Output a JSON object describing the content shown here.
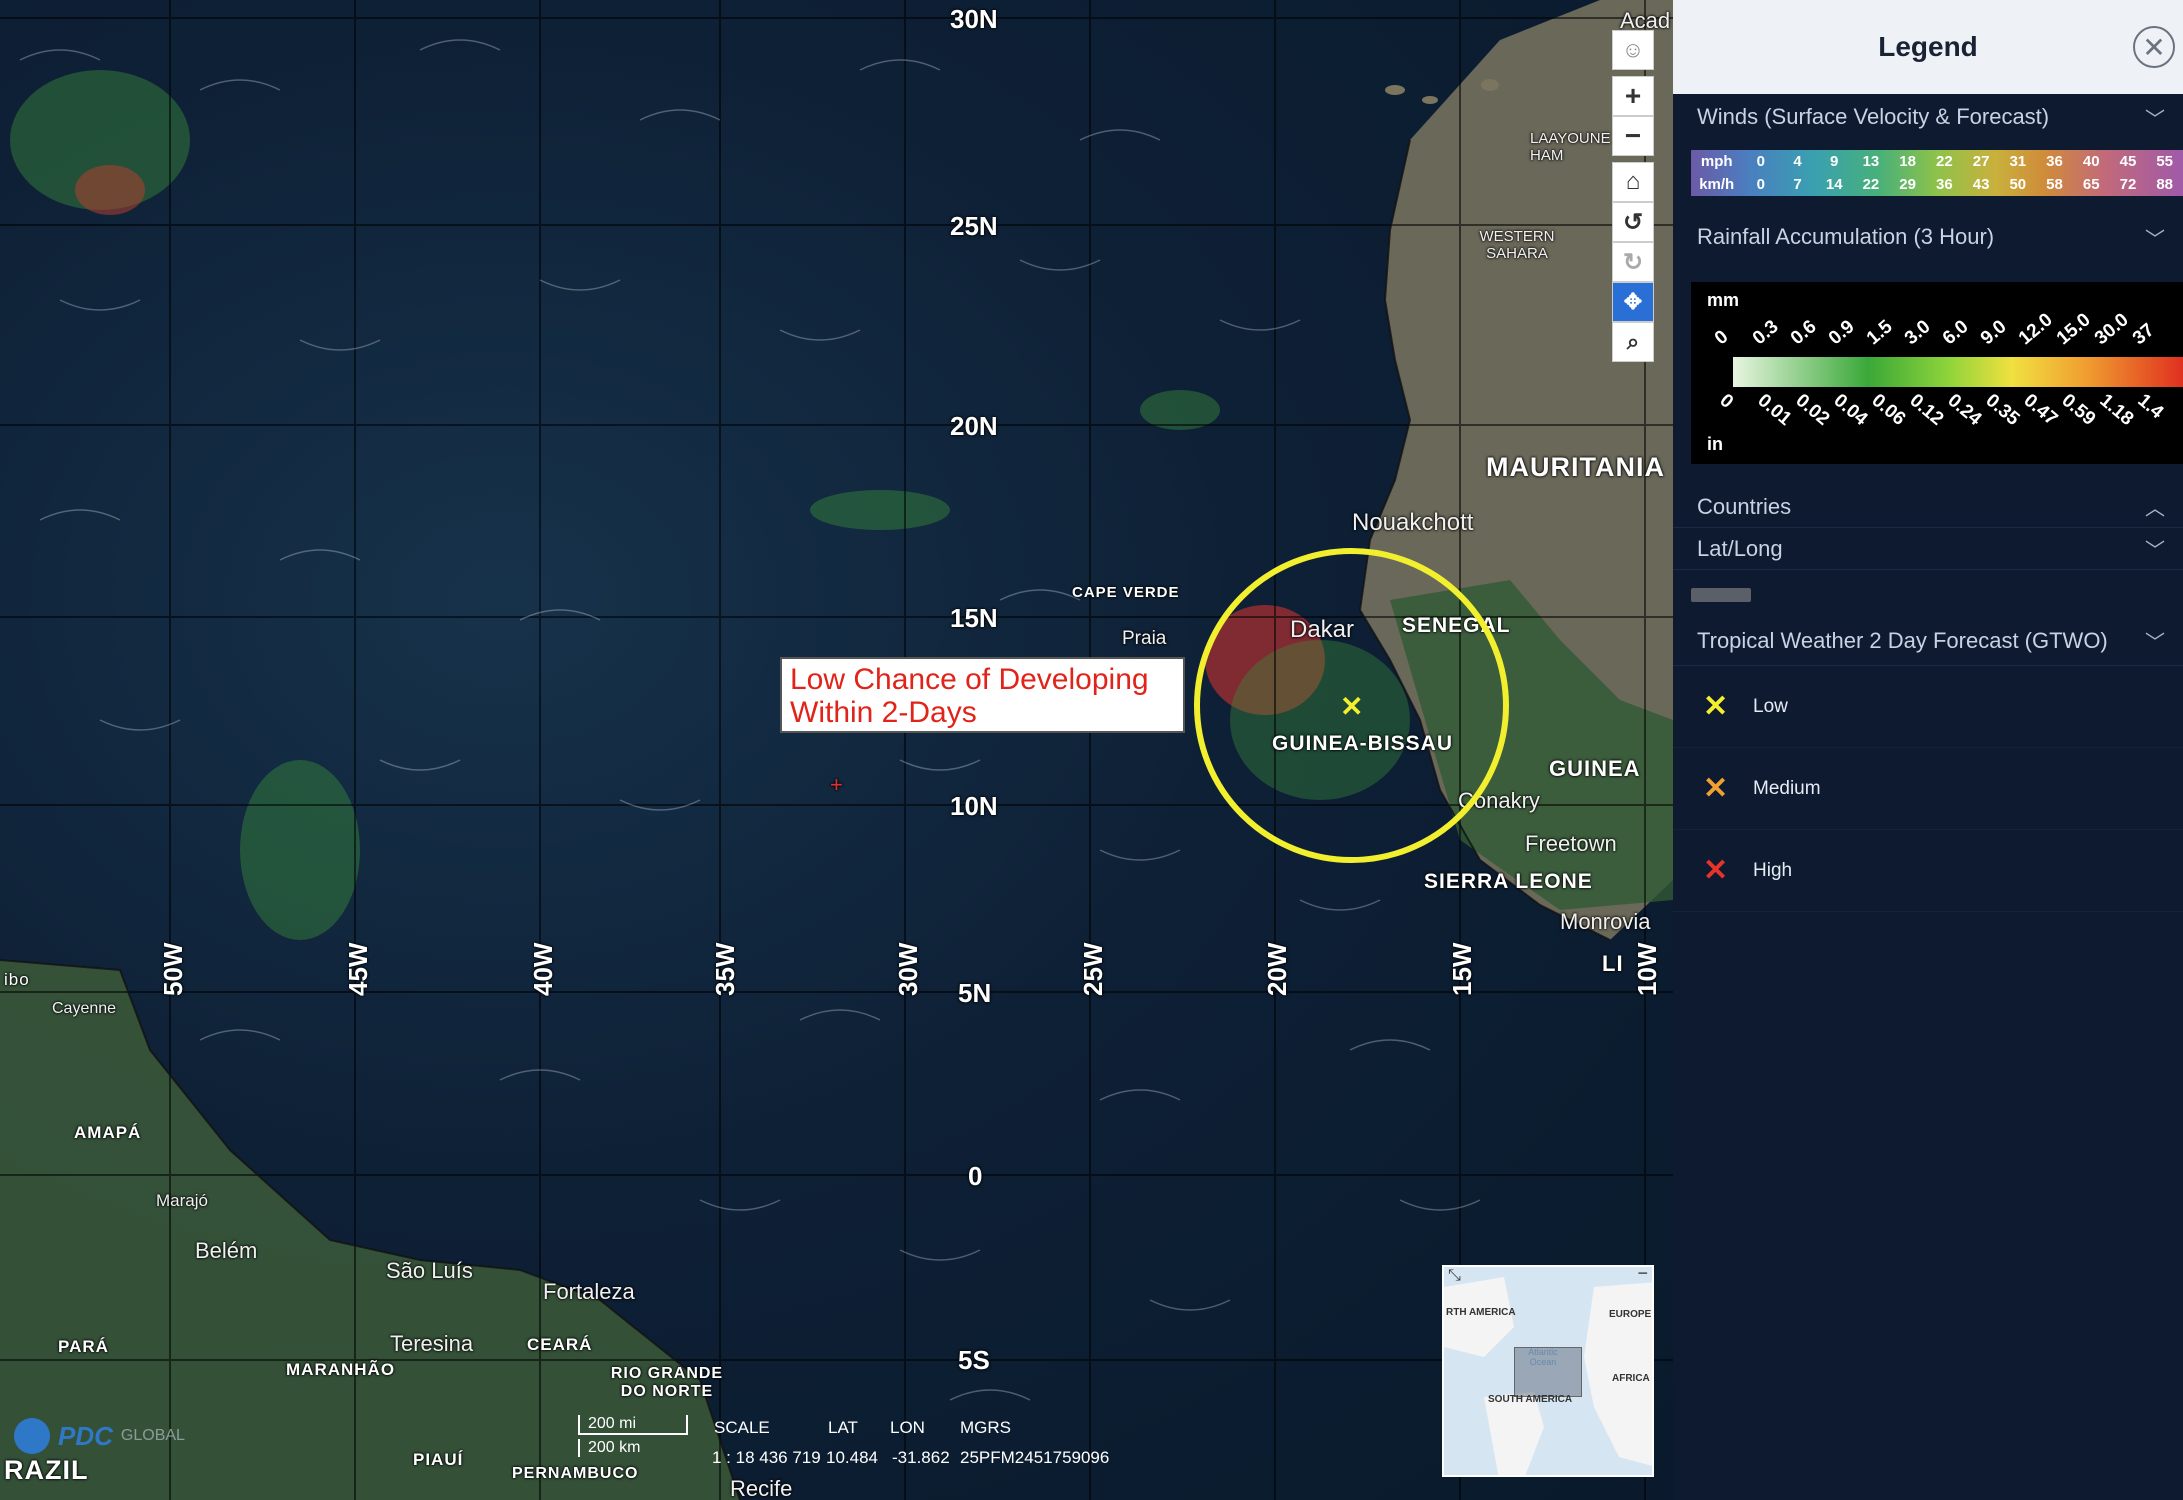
{
  "map": {
    "latitudes": [
      "30N",
      "25N",
      "20N",
      "15N",
      "10N",
      "5N",
      "0",
      "5S"
    ],
    "longitudes": [
      "50W",
      "45W",
      "40W",
      "35W",
      "30W",
      "25W",
      "20W",
      "15W",
      "10W"
    ],
    "places": {
      "nouakchott": "Nouakchott",
      "dakar": "Dakar",
      "praia": "Praia",
      "conakry": "Conakry",
      "freetown": "Freetown",
      "monrovia": "Monrovia",
      "cayenne": "Cayenne",
      "marajo": "Marajó",
      "belem": "Belém",
      "sao_luis": "São Luís",
      "fortaleza": "Fortaleza",
      "teresina": "Teresina",
      "recife": "Recife",
      "acad": "Acad",
      "laayoune": "LAAYOUNE EL HAM",
      "western_sahara": "WESTERN SAHARA"
    },
    "countries": {
      "mauritania": "MAURITANIA",
      "senegal": "SENEGAL",
      "cape_verde": "CAPE VERDE",
      "guinea_bissau": "GUINEA-BISSAU",
      "guinea": "GUINEA",
      "sierra_leone": "SIERRA LEONE",
      "liberia": "LI",
      "amapa": "AMAPÁ",
      "para": "PARÁ",
      "maranhao": "MARANHÃO",
      "ceara": "CEARÁ",
      "rio_grande": "RIO GRANDE DO NORTE",
      "piaui": "PIAUÍ",
      "pernambuco": "PERNAMBUCO",
      "brazil": "RAZIL",
      "ibo": "ibo"
    },
    "callout": {
      "line1": "Low Chance of Developing",
      "line2": "Within 2-Days"
    },
    "marker_glyph": "✕",
    "ring_color": "#f2ef2e",
    "crosshair": "+",
    "minimap": {
      "north_america": "RTH AMERICA",
      "europe": "EUROPE",
      "atlantic": "Atlantic Ocean",
      "africa": "AFRICA",
      "south_america": "SOUTH AMERICA"
    },
    "scale": {
      "mi": "200 mi",
      "km": "200 km"
    },
    "readout": {
      "scale_label": "SCALE",
      "scale_value": "1 : 18 436 719",
      "lat_label": "LAT",
      "lat_value": "10.484",
      "lon_label": "LON",
      "lon_value": "-31.862",
      "mgrs_label": "MGRS",
      "mgrs_value": "25PFM2451759096"
    },
    "logo": {
      "pdc": "PDC",
      "global": "GLOBAL"
    }
  },
  "toolbar": {
    "icons": [
      "person-icon",
      "zoom-in-icon",
      "zoom-out-icon",
      "home-icon",
      "rotate-left-icon",
      "rotate-right-icon",
      "pan-icon",
      "zoom-box-icon"
    ]
  },
  "legend": {
    "title": "Legend",
    "close_glyph": "✕",
    "winds": {
      "title": "Winds (Surface Velocity & Forecast)",
      "mph_label": "mph",
      "mph": [
        "0",
        "4",
        "9",
        "13",
        "18",
        "22",
        "27",
        "31",
        "36",
        "40",
        "45",
        "55"
      ],
      "kmh_label": "km/h",
      "kmh": [
        "0",
        "7",
        "14",
        "22",
        "29",
        "36",
        "43",
        "50",
        "58",
        "65",
        "72",
        "88"
      ]
    },
    "rainfall": {
      "title": "Rainfall Accumulation (3 Hour)",
      "mm_label": "mm",
      "mm": [
        "0",
        "0.3",
        "0.6",
        "0.9",
        "1.5",
        "3.0",
        "6.0",
        "9.0",
        "12.0",
        "15.0",
        "30.0",
        "37"
      ],
      "in_label": "in",
      "in": [
        "0",
        "0.01",
        "0.02",
        "0.04",
        "0.06",
        "0.12",
        "0.24",
        "0.35",
        "0.47",
        "0.59",
        "1.18",
        "1.4"
      ]
    },
    "countries": {
      "title": "Countries"
    },
    "latlong": {
      "title": "Lat/Long"
    },
    "gtwo": {
      "title": "Tropical Weather 2 Day Forecast (GTWO)",
      "items": [
        {
          "label": "Low",
          "color": "#f2ef2e"
        },
        {
          "label": "Medium",
          "color": "#f0a030"
        },
        {
          "label": "High",
          "color": "#e8332a"
        }
      ]
    },
    "chevron_down": "﹀",
    "chevron_up": "︿"
  }
}
